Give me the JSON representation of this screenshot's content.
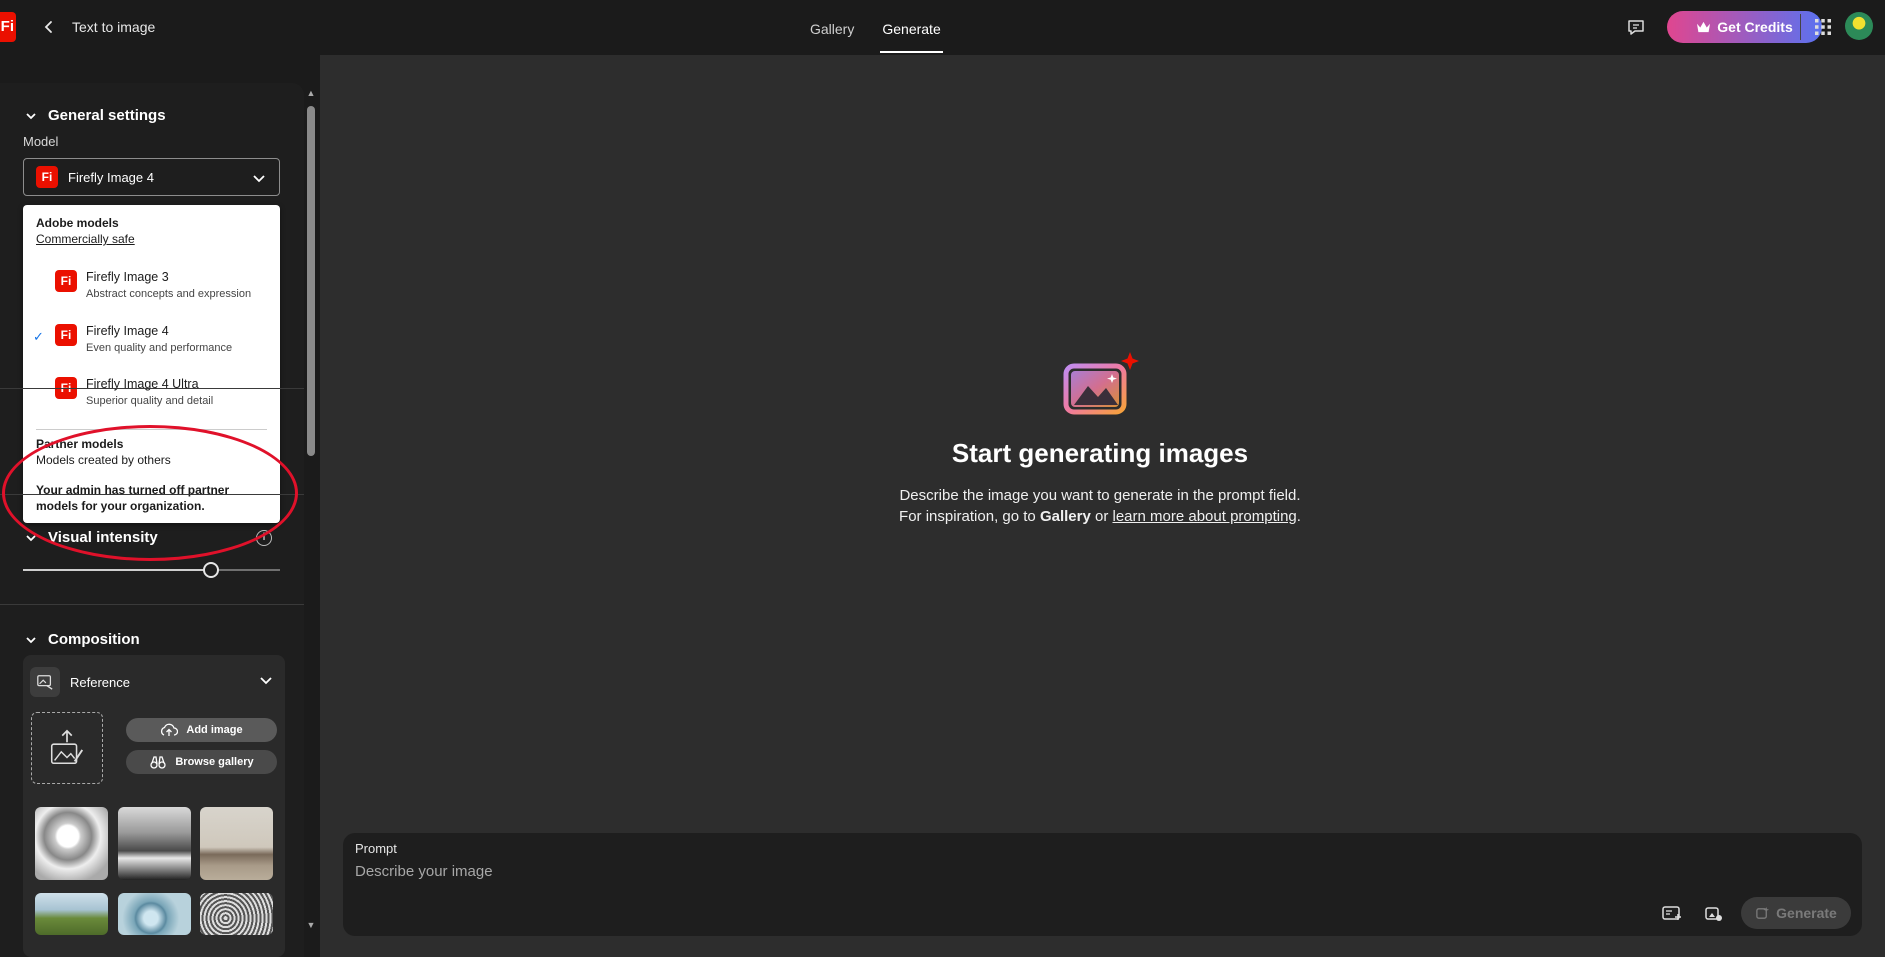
{
  "header": {
    "logo_text": "Fi",
    "title": "Text to image",
    "tabs": [
      {
        "label": "Gallery",
        "active": false
      },
      {
        "label": "Generate",
        "active": true
      }
    ],
    "get_credits_label": "Get Credits",
    "accent_gradient": [
      "#e0468f",
      "#5a72f0"
    ]
  },
  "sidebar": {
    "general_settings": {
      "heading": "General settings",
      "model_label": "Model",
      "selected_model": "Firefly Image 4",
      "badge_text": "Fi"
    },
    "model_dropdown": {
      "adobe_group_title": "Adobe models",
      "adobe_group_sub": "Commercially safe",
      "items": [
        {
          "name": "Firefly Image 3",
          "desc": "Abstract concepts and expression",
          "badge": "Fi",
          "selected": false
        },
        {
          "name": "Firefly Image 4",
          "desc": "Even quality and performance",
          "badge": "Fi",
          "selected": true
        },
        {
          "name": "Firefly Image 4 Ultra",
          "desc": "Superior quality and detail",
          "badge": "Fi",
          "selected": false
        }
      ],
      "partner_group_title": "Partner models",
      "partner_group_sub": "Models created by others",
      "partner_note": "Your admin has turned off partner models for your organization."
    },
    "visual_intensity": {
      "heading": "Visual intensity",
      "value_fraction": 0.73
    },
    "composition": {
      "heading": "Composition",
      "reference_label": "Reference",
      "add_image_label": "Add image",
      "browse_gallery_label": "Browse gallery"
    }
  },
  "main": {
    "empty_title": "Start generating images",
    "line1": "Describe the image you want to generate in the prompt field.",
    "line2_prefix": "For inspiration, go to ",
    "line2_gallery": "Gallery",
    "line2_or": " or ",
    "line2_link": "learn more about prompting",
    "line2_suffix": "."
  },
  "prompt": {
    "label": "Prompt",
    "placeholder": "Describe your image",
    "generate_label": "Generate"
  },
  "colors": {
    "brand_red": "#eb1000",
    "annotation_red": "#e0112a",
    "check_blue": "#1473e6"
  }
}
